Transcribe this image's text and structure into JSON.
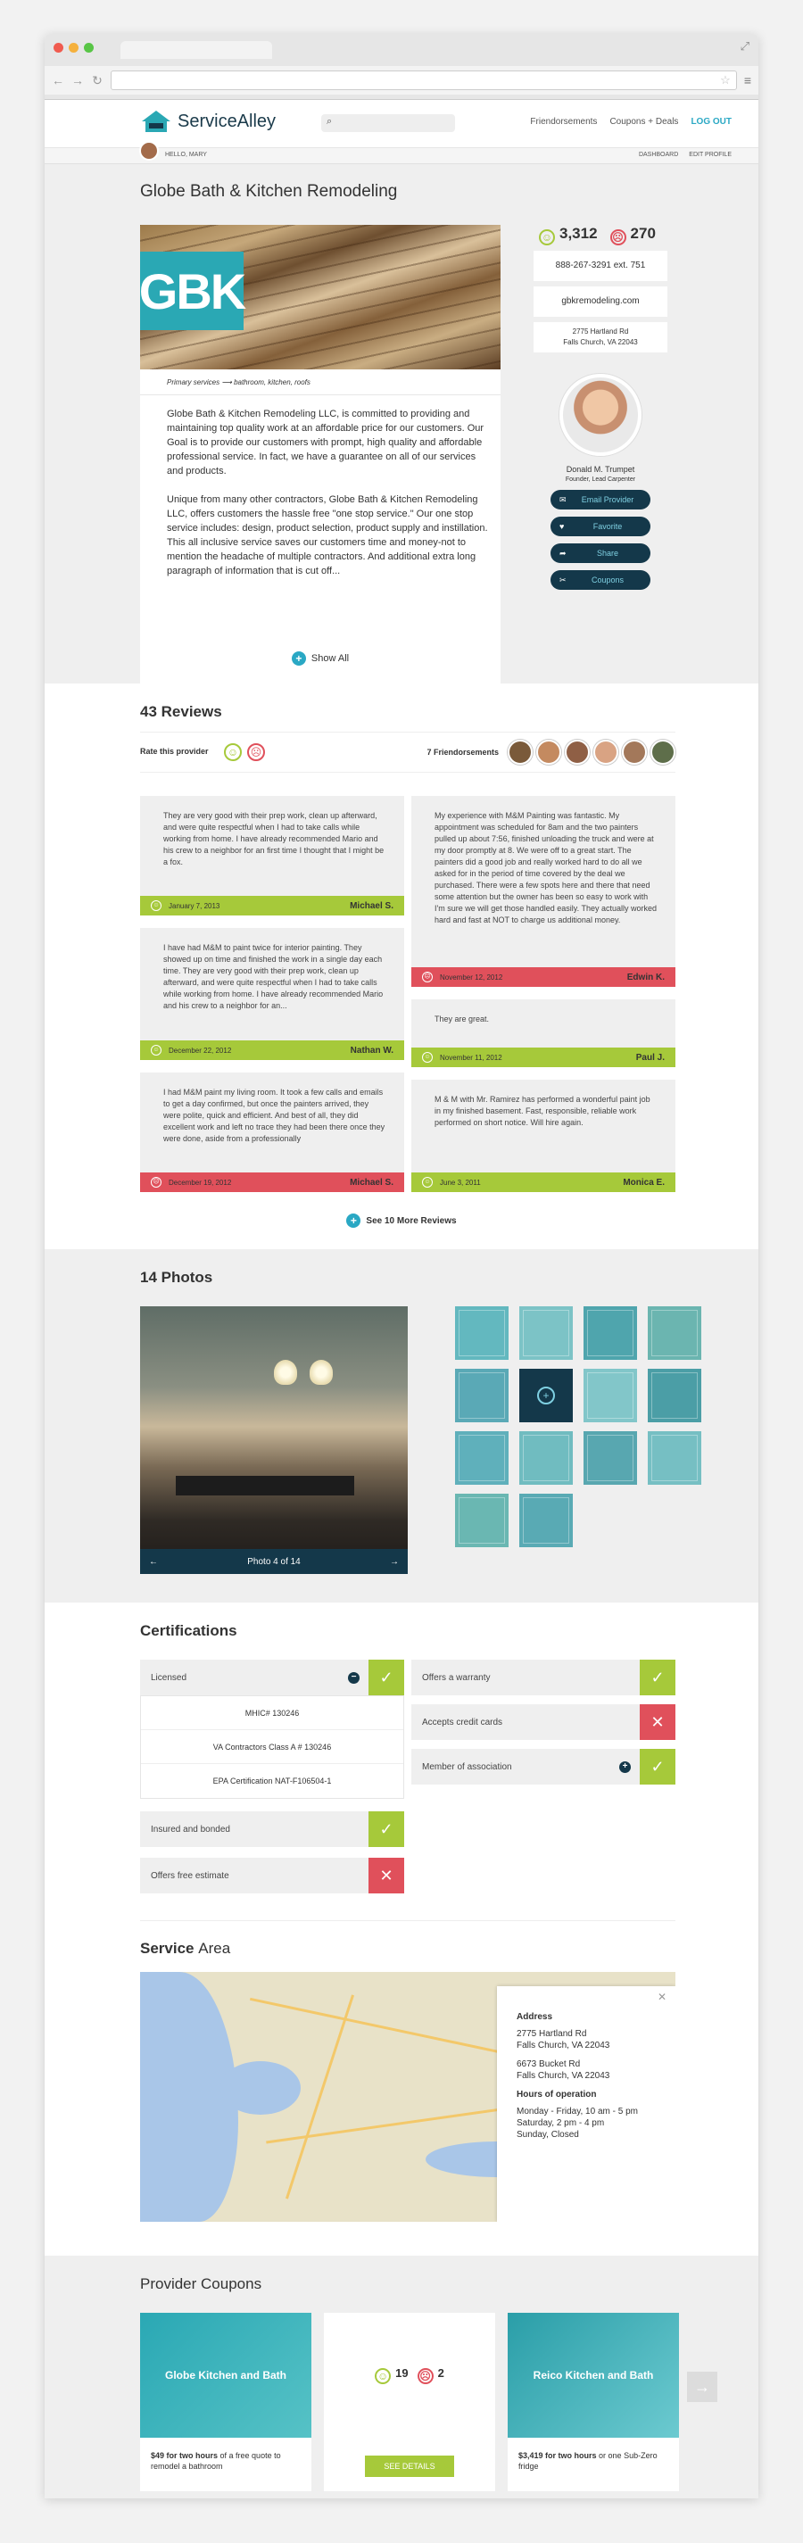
{
  "header": {
    "logo_text": "ServiceAlley",
    "nav": [
      "Friendorsements",
      "Coupons + Deals",
      "LOG OUT"
    ],
    "hello": "HELLO, MARY",
    "sublinks": [
      "DASHBOARD",
      "EDIT PROFILE"
    ]
  },
  "provider": {
    "name": "Globe Bath & Kitchen Remodeling",
    "logo": "GBK",
    "primary_services_label": "Primary services",
    "primary_services": "bathroom, kitchen, roofs",
    "desc1": "Globe Bath & Kitchen Remodeling LLC, is committed to providing and maintaining top quality work at an affordable price for our customers. Our Goal is to provide our customers with prompt, high quality and affordable professional service. In fact, we have a guarantee on all of our services and products.",
    "desc2": "Unique from many other contractors, Globe Bath & Kitchen Remodeling LLC, offers customers the hassle free \"one stop service.\" Our one stop service includes: design, product selection, product supply and instillation. This all inclusive service saves our customers time and money-not to mention the headache of multiple contractors. And additional extra long paragraph of information that is cut off...",
    "show_all": "Show All",
    "positive": "3,312",
    "negative": "270",
    "phone": "888-267-3291 ext. 751",
    "website": "gbkremodeling.com",
    "address1": "2775 Hartland Rd",
    "address2": "Falls Church, VA 22043",
    "person_name": "Donald M. Trumpet",
    "person_title": "Founder, Lead Carpenter",
    "buttons": [
      "Email Provider",
      "Favorite",
      "Share",
      "Coupons"
    ]
  },
  "reviews": {
    "title": "43 Reviews",
    "rate_label": "Rate this provider",
    "friend_count": "7 Friendorsements",
    "items": [
      {
        "text": "They are very good with their prep work, clean up afterward, and were quite respectful when I had to take calls while working from home. I have already recommended Mario and his crew to a neighbor for an first time I thought that I might be a fox.",
        "date": "January 7, 2013",
        "name": "Michael S."
      },
      {
        "text": "I have had M&M to paint twice for interior painting. They showed up on time and finished the work in a single day each time. They are very good with their prep work, clean up afterward, and were quite respectful when I had to take calls while working from home. I have already recommended Mario and his crew to a neighbor for an...",
        "date": "December 22, 2012",
        "name": "Nathan W."
      },
      {
        "text": "I had M&M paint my living room. It took a few calls and emails to get a day confirmed, but once the painters arrived, they were polite, quick and efficient. And best of all, they did excellent work and left no trace they had been there once they were done, aside from a professionally",
        "date": "December 19, 2012",
        "name": "Michael S."
      },
      {
        "text": "My experience with M&M Painting was fantastic. My appointment was scheduled for 8am and the two painters pulled up about 7:56, finished unloading the truck and were at my door promptly at 8. We were off to a great start. The painters did a good job and really worked hard to do all we asked for in the period of time covered by the deal we purchased. There were a few spots here and there that need some attention but the owner has been so easy to work with I'm sure we will get those handled easily. They actually worked hard and fast at NOT to charge us additional money.",
        "date": "November 12, 2012",
        "name": "Edwin K."
      },
      {
        "text": "They are great.",
        "date": "November 11, 2012",
        "name": "Paul J."
      },
      {
        "text": "M & M with Mr. Ramirez has performed a wonderful paint job in my finished basement. Fast, responsible, reliable work performed on short notice. Will hire again.",
        "date": "June 3, 2011",
        "name": "Monica E."
      }
    ],
    "more": "See 10 More Reviews"
  },
  "photos": {
    "title": "14 Photos",
    "caption": "Photo 4 of 14"
  },
  "certs": {
    "title": "Certifications",
    "licensed": "Licensed",
    "licenses": [
      "MHIC# 130246",
      "VA Contractors Class A # 130246",
      "EPA Certification NAT-F106504-1"
    ],
    "insured": "Insured and bonded",
    "estimate": "Offers free estimate",
    "warranty": "Offers a warranty",
    "cards": "Accepts credit cards",
    "member": "Member of association"
  },
  "service_area": {
    "title_a": "Service",
    "title_b": "Area",
    "address_label": "Address",
    "addr1a": "2775 Hartland Rd",
    "addr1b": "Falls Church, VA 22043",
    "addr2a": "6673 Bucket Rd",
    "addr2b": "Falls Church, VA 22043",
    "hours_label": "Hours of operation",
    "hours1": "Monday - Friday, 10 am - 5 pm",
    "hours2": "Saturday, 2 pm - 4 pm",
    "hours3": "Sunday, Closed"
  },
  "coupons": {
    "title": "Provider Coupons",
    "c1_name": "Globe Kitchen and Bath",
    "c1_text_b": "$49 for two hours",
    "c1_text": "of a free quote to remodel a bathroom",
    "c2_pos": "19",
    "c2_neg": "2",
    "c2_btn": "SEE DETAILS",
    "c3_name": "Reico Kitchen and Bath",
    "c3_text_b": "$3,419 for two hours",
    "c3_text": "or one Sub-Zero fridge"
  },
  "colors": {
    "accent": "#2aa8c4",
    "green": "#a6c93a",
    "red": "#e0505b",
    "navy": "#14384a"
  }
}
